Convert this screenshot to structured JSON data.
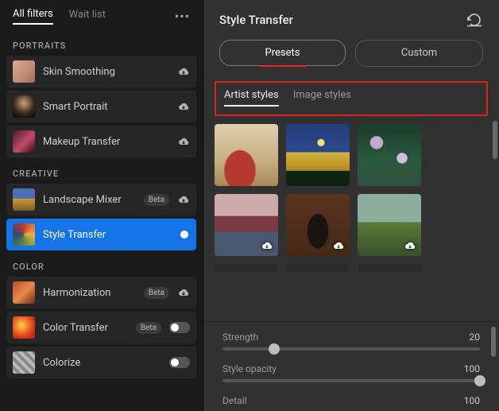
{
  "left": {
    "tabs": {
      "all": "All filters",
      "wait": "Wait list"
    },
    "sections": {
      "portraits": "PORTRAITS",
      "creative": "CREATIVE",
      "color": "COLOR"
    },
    "filters": {
      "skin": "Skin Smoothing",
      "smart_portrait": "Smart Portrait",
      "makeup": "Makeup Transfer",
      "landscape": "Landscape Mixer",
      "style": "Style Transfer",
      "harmonization": "Harmonization",
      "color_transfer": "Color Transfer",
      "colorize": "Colorize"
    },
    "beta": "Beta"
  },
  "right": {
    "title": "Style Transfer",
    "tabs": {
      "presets": "Presets",
      "custom": "Custom"
    },
    "subtabs": {
      "artist": "Artist styles",
      "image": "Image styles"
    },
    "sliders": {
      "strength": {
        "label": "Strength",
        "value": "20",
        "pos": 20
      },
      "opacity": {
        "label": "Style opacity",
        "value": "100",
        "pos": 100
      },
      "detail": {
        "label": "Detail",
        "value": "100",
        "pos": 100
      }
    }
  }
}
